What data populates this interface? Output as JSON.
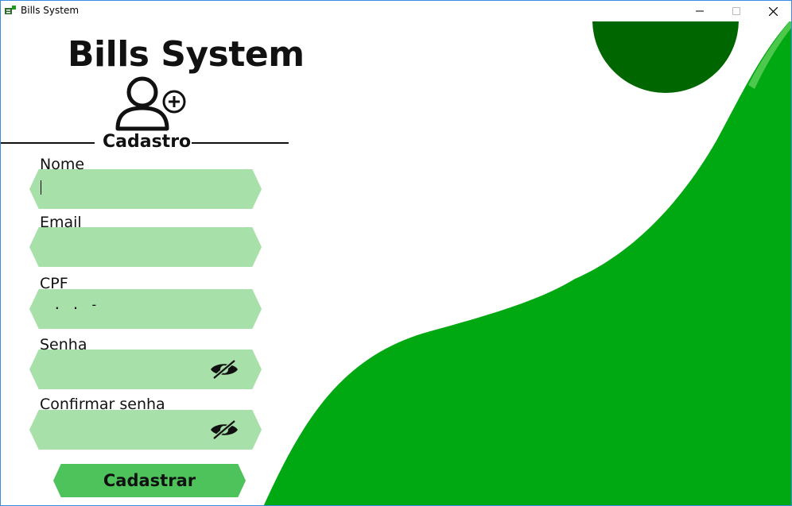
{
  "window": {
    "title": "Bills System",
    "minimize_icon": "minimize-icon",
    "maximize_icon": "maximize-icon",
    "close_icon": "close-icon"
  },
  "header": {
    "app_title": "Bills System",
    "icon": "user-add-icon",
    "section_title": "Cadastro"
  },
  "form": {
    "fields": [
      {
        "label": "Nome",
        "value": ""
      },
      {
        "label": "Email",
        "value": ""
      },
      {
        "label": "CPF",
        "value": "",
        "mask": ". . -"
      },
      {
        "label": "Senha",
        "value": "",
        "icon": "eye-slash-icon"
      },
      {
        "label": "Confirmar senha",
        "value": "",
        "icon": "eye-slash-icon"
      }
    ],
    "submit_label": "Cadastrar"
  },
  "colors": {
    "field_bg": "#a8e0a9",
    "button_bg": "#4ec25b",
    "wave_green": "#00a811",
    "circle_green": "#006600"
  }
}
